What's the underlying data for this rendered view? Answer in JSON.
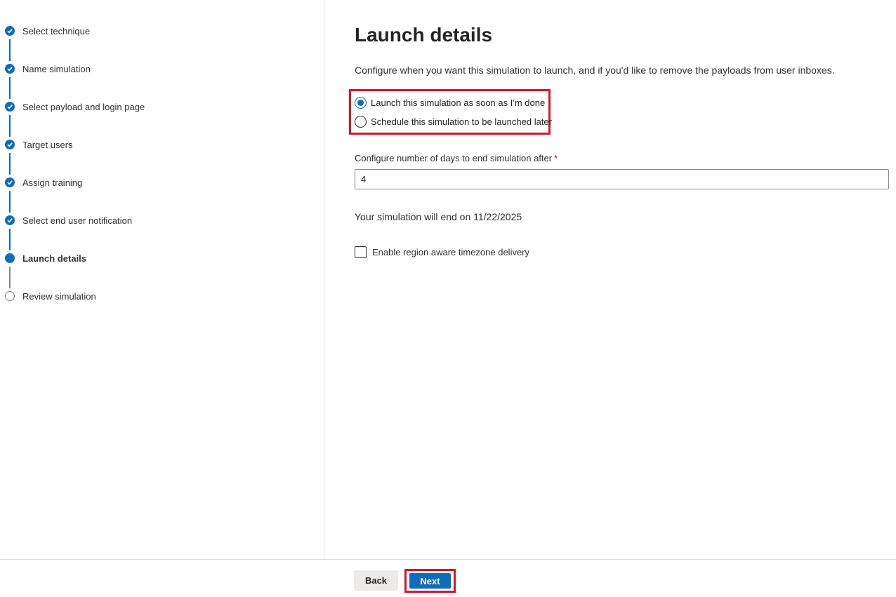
{
  "steps": [
    {
      "label": "Select technique",
      "state": "done"
    },
    {
      "label": "Name simulation",
      "state": "done"
    },
    {
      "label": "Select payload and login page",
      "state": "done"
    },
    {
      "label": "Target users",
      "state": "done"
    },
    {
      "label": "Assign training",
      "state": "done"
    },
    {
      "label": "Select end user notification",
      "state": "done"
    },
    {
      "label": "Launch details",
      "state": "current"
    },
    {
      "label": "Review simulation",
      "state": "todo"
    }
  ],
  "main": {
    "title": "Launch details",
    "description": "Configure when you want this simulation to launch, and if you'd like to remove the payloads from user inboxes.",
    "launch_options": [
      {
        "label": "Launch this simulation as soon as I'm done",
        "checked": true
      },
      {
        "label": "Schedule this simulation to be launched later",
        "checked": false
      }
    ],
    "days_field": {
      "label": "Configure number of days to end simulation after",
      "required_mark": "*",
      "value": "4"
    },
    "end_text": "Your simulation will end on 11/22/2025",
    "timezone_checkbox": {
      "label": "Enable region aware timezone delivery",
      "checked": false
    }
  },
  "footer": {
    "back_label": "Back",
    "next_label": "Next"
  },
  "colors": {
    "accent": "#0f6cbd",
    "highlight": "#d1182a",
    "required": "#c50f1f"
  }
}
